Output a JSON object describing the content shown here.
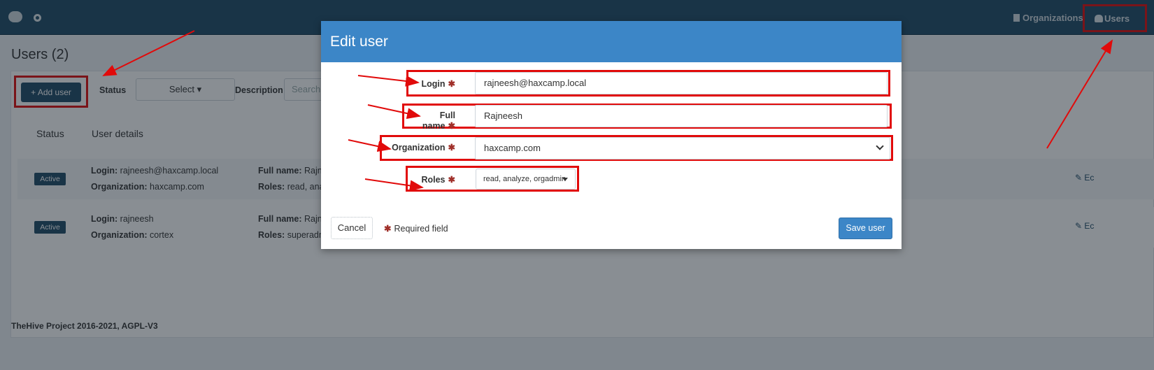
{
  "navbar": {
    "organizations_label": "Organizations",
    "users_label": "Users"
  },
  "page": {
    "title": "Users (2)",
    "add_user_label": "Add user",
    "filters": {
      "status_label": "Status",
      "status_select": "Select",
      "description_label": "Description",
      "search_placeholder": "Search"
    },
    "table": {
      "headers": [
        "Status",
        "User details"
      ],
      "rows": [
        {
          "status": "Active",
          "login_label": "Login:",
          "login": "rajneesh@haxcamp.local",
          "org_label": "Organization:",
          "organization": "haxcamp.com",
          "fullname_label": "Full name:",
          "fullname": "Rajne",
          "roles_label": "Roles:",
          "roles": "read, anal",
          "edit": "Ec"
        },
        {
          "status": "Active",
          "login_label": "Login:",
          "login": "rajneesh",
          "org_label": "Organization:",
          "organization": "cortex",
          "fullname_label": "Full name:",
          "fullname": "Rajne",
          "roles_label": "Roles:",
          "roles": "superadm",
          "edit": "Ec"
        }
      ]
    },
    "footer": "TheHive Project 2016-2021, AGPL-V3"
  },
  "modal": {
    "title": "Edit user",
    "fields": {
      "login_label": "Login",
      "login_value": "rajneesh@haxcamp.local",
      "fullname_label": "Full name",
      "fullname_value": "Rajneesh",
      "organization_label": "Organization",
      "organization_value": "haxcamp.com",
      "roles_label": "Roles",
      "roles_value": "read, analyze, orgadmin"
    },
    "required_marker": "✱",
    "cancel_label": "Cancel",
    "required_note": "Required field",
    "save_label": "Save user"
  },
  "colors": {
    "navbar": "#1f4a66",
    "modal_header": "#3c86c7",
    "annotation": "#e10a0a",
    "required": "#a0302a"
  },
  "icons": [
    "brain-logo-icon",
    "document-icon",
    "users-icon",
    "plus-icon",
    "edit-icon",
    "chevron-down-icon"
  ]
}
